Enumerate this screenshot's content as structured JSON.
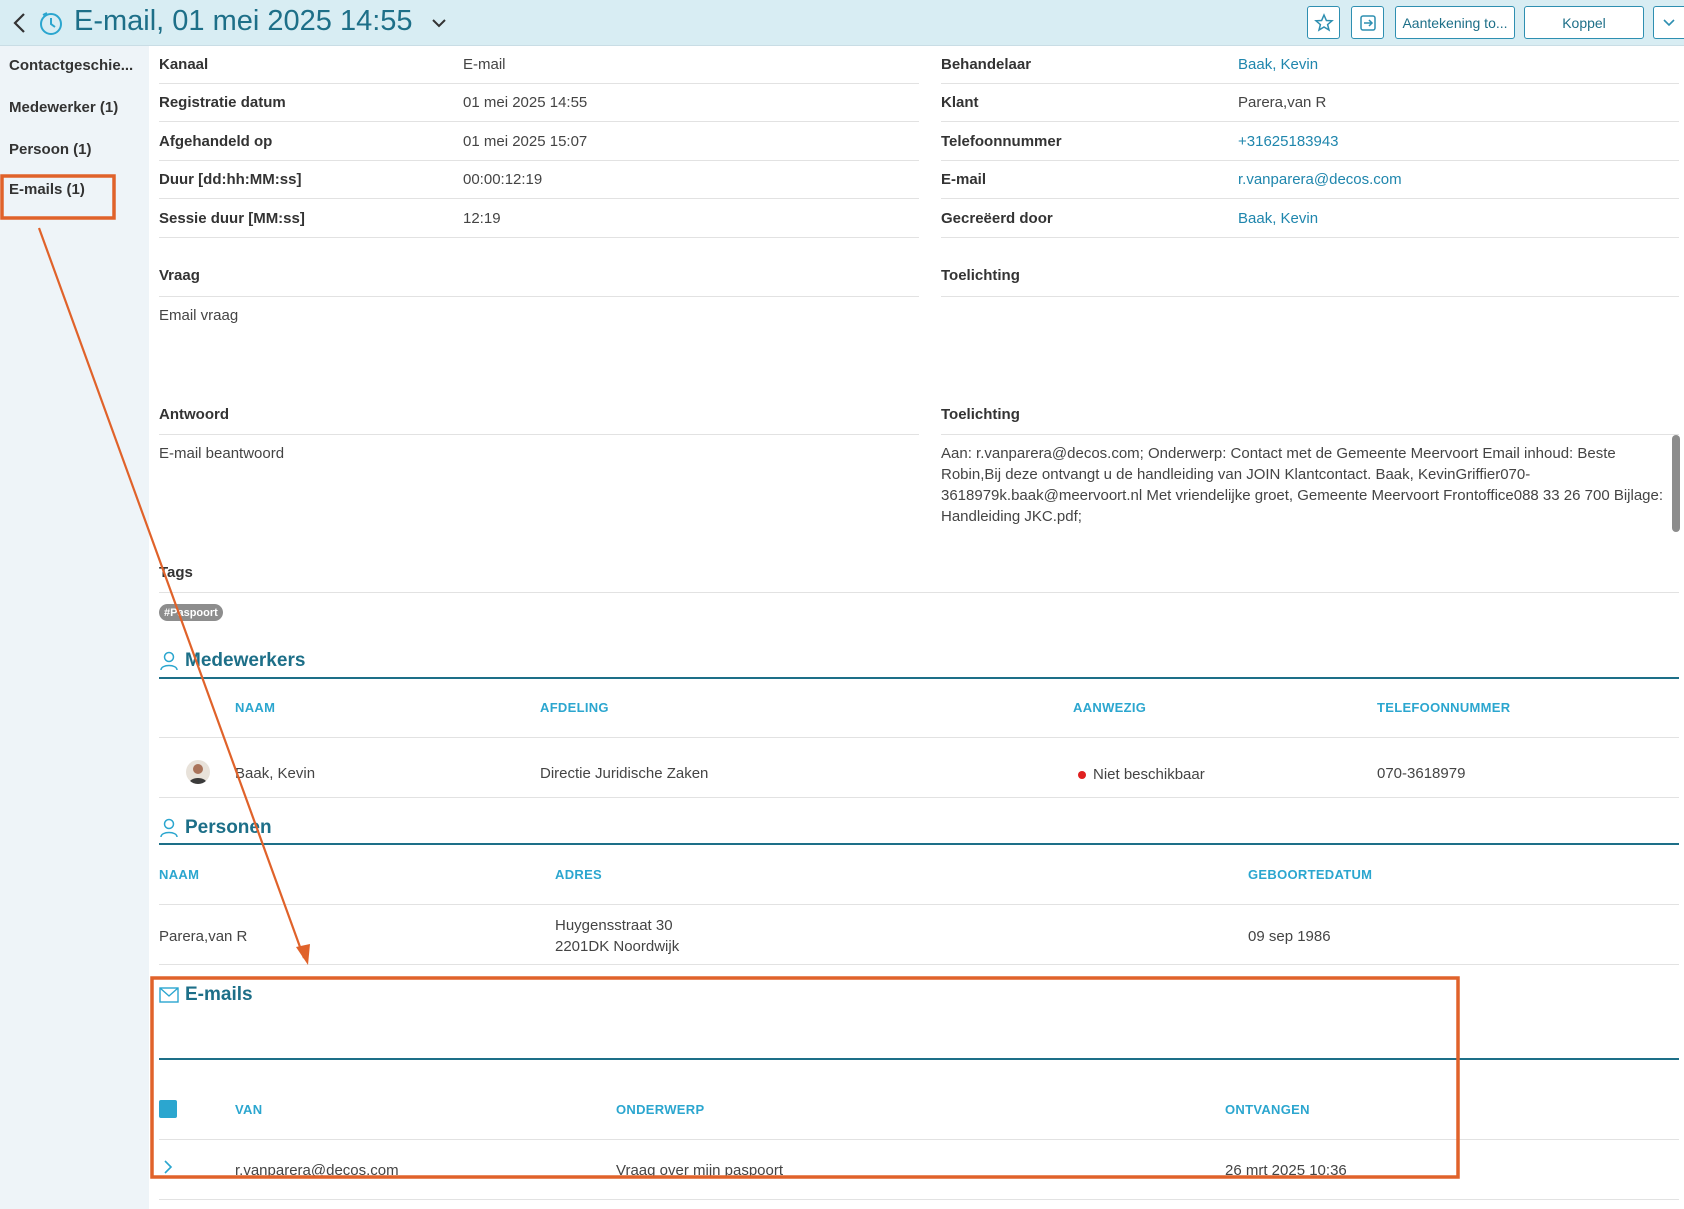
{
  "header": {
    "title": "E-mail, 01 mei 2025 14:55",
    "buttons": {
      "annotation": "Aantekening to...",
      "koppel": "Koppel"
    }
  },
  "sidebar": {
    "items": [
      {
        "label": "Contactgeschie..."
      },
      {
        "label": "Medewerker (1)"
      },
      {
        "label": "Persoon (1)"
      },
      {
        "label": "E-mails (1)"
      }
    ]
  },
  "details_left": [
    {
      "label": "Kanaal",
      "value": "E-mail"
    },
    {
      "label": "Registratie datum",
      "value": "01 mei 2025 14:55"
    },
    {
      "label": "Afgehandeld op",
      "value": "01 mei 2025 15:07"
    },
    {
      "label": "Duur [dd:hh:MM:ss]",
      "value": "00:00:12:19"
    },
    {
      "label": "Sessie duur [MM:ss]",
      "value": "12:19"
    }
  ],
  "details_right": [
    {
      "label": "Behandelaar",
      "value": "Baak, Kevin"
    },
    {
      "label": "Klant",
      "value": "Parera,van R"
    },
    {
      "label": "Telefoonnummer",
      "value": "+31625183943"
    },
    {
      "label": "E-mail",
      "value": "r.vanparera@decos.com"
    },
    {
      "label": "Gecreëerd door",
      "value": "Baak, Kevin"
    }
  ],
  "vraag": {
    "label": "Vraag",
    "text": "Email vraag",
    "toelichting_label": "Toelichting"
  },
  "antwoord": {
    "label": "Antwoord",
    "text": "E-mail beantwoord",
    "toelichting_label": "Toelichting",
    "toelichting_text": "Aan: r.vanparera@decos.com; Onderwerp: Contact met de Gemeente Meervoort Email inhoud: Beste Robin,Bij deze ontvangt u de handleiding van JOIN Klantcontact. Baak, KevinGriffier070-3618979k.baak@meervoort.nl Met vriendelijke groet, Gemeente Meervoort Frontoffice088 33 26 700 Bijlage: Handleiding JKC.pdf;"
  },
  "tags": {
    "label": "Tags",
    "items": [
      "#Paspoort"
    ]
  },
  "medewerkers": {
    "heading": "Medewerkers",
    "columns": [
      "NAAM",
      "AFDELING",
      "AANWEZIG",
      "TELEFOONNUMMER"
    ],
    "rows": [
      {
        "naam": "Baak, Kevin",
        "afdeling": "Directie Juridische Zaken",
        "aanwezig": "Niet beschikbaar",
        "telefoon": "070-3618979"
      }
    ],
    "status_color": "#e02020"
  },
  "personen": {
    "heading": "Personen",
    "columns": [
      "NAAM",
      "ADRES",
      "GEBOORTEDATUM"
    ],
    "rows": [
      {
        "naam": "Parera,van R",
        "adres_line1": "Huygensstraat 30",
        "adres_line2": "2201DK Noordwijk",
        "geboortedatum": "09 sep 1986"
      }
    ]
  },
  "emails": {
    "heading": "E-mails",
    "columns": [
      "VAN",
      "ONDERWERP",
      "ONTVANGEN"
    ],
    "rows": [
      {
        "van": "r.vanparera@decos.com",
        "onderwerp": "Vraag over mijn paspoort",
        "ontvangen": "26 mrt 2025 10:36"
      }
    ]
  },
  "colors": {
    "accent": "#1d6f88",
    "column_header": "#2ba6cf",
    "link": "#1f86ad",
    "annotation": "#e0622a"
  },
  "icons": [
    "back-icon",
    "clock-icon",
    "chevron-down-icon",
    "star-icon",
    "exit-icon",
    "person-icon",
    "envelope-icon",
    "chevron-right-icon"
  ]
}
